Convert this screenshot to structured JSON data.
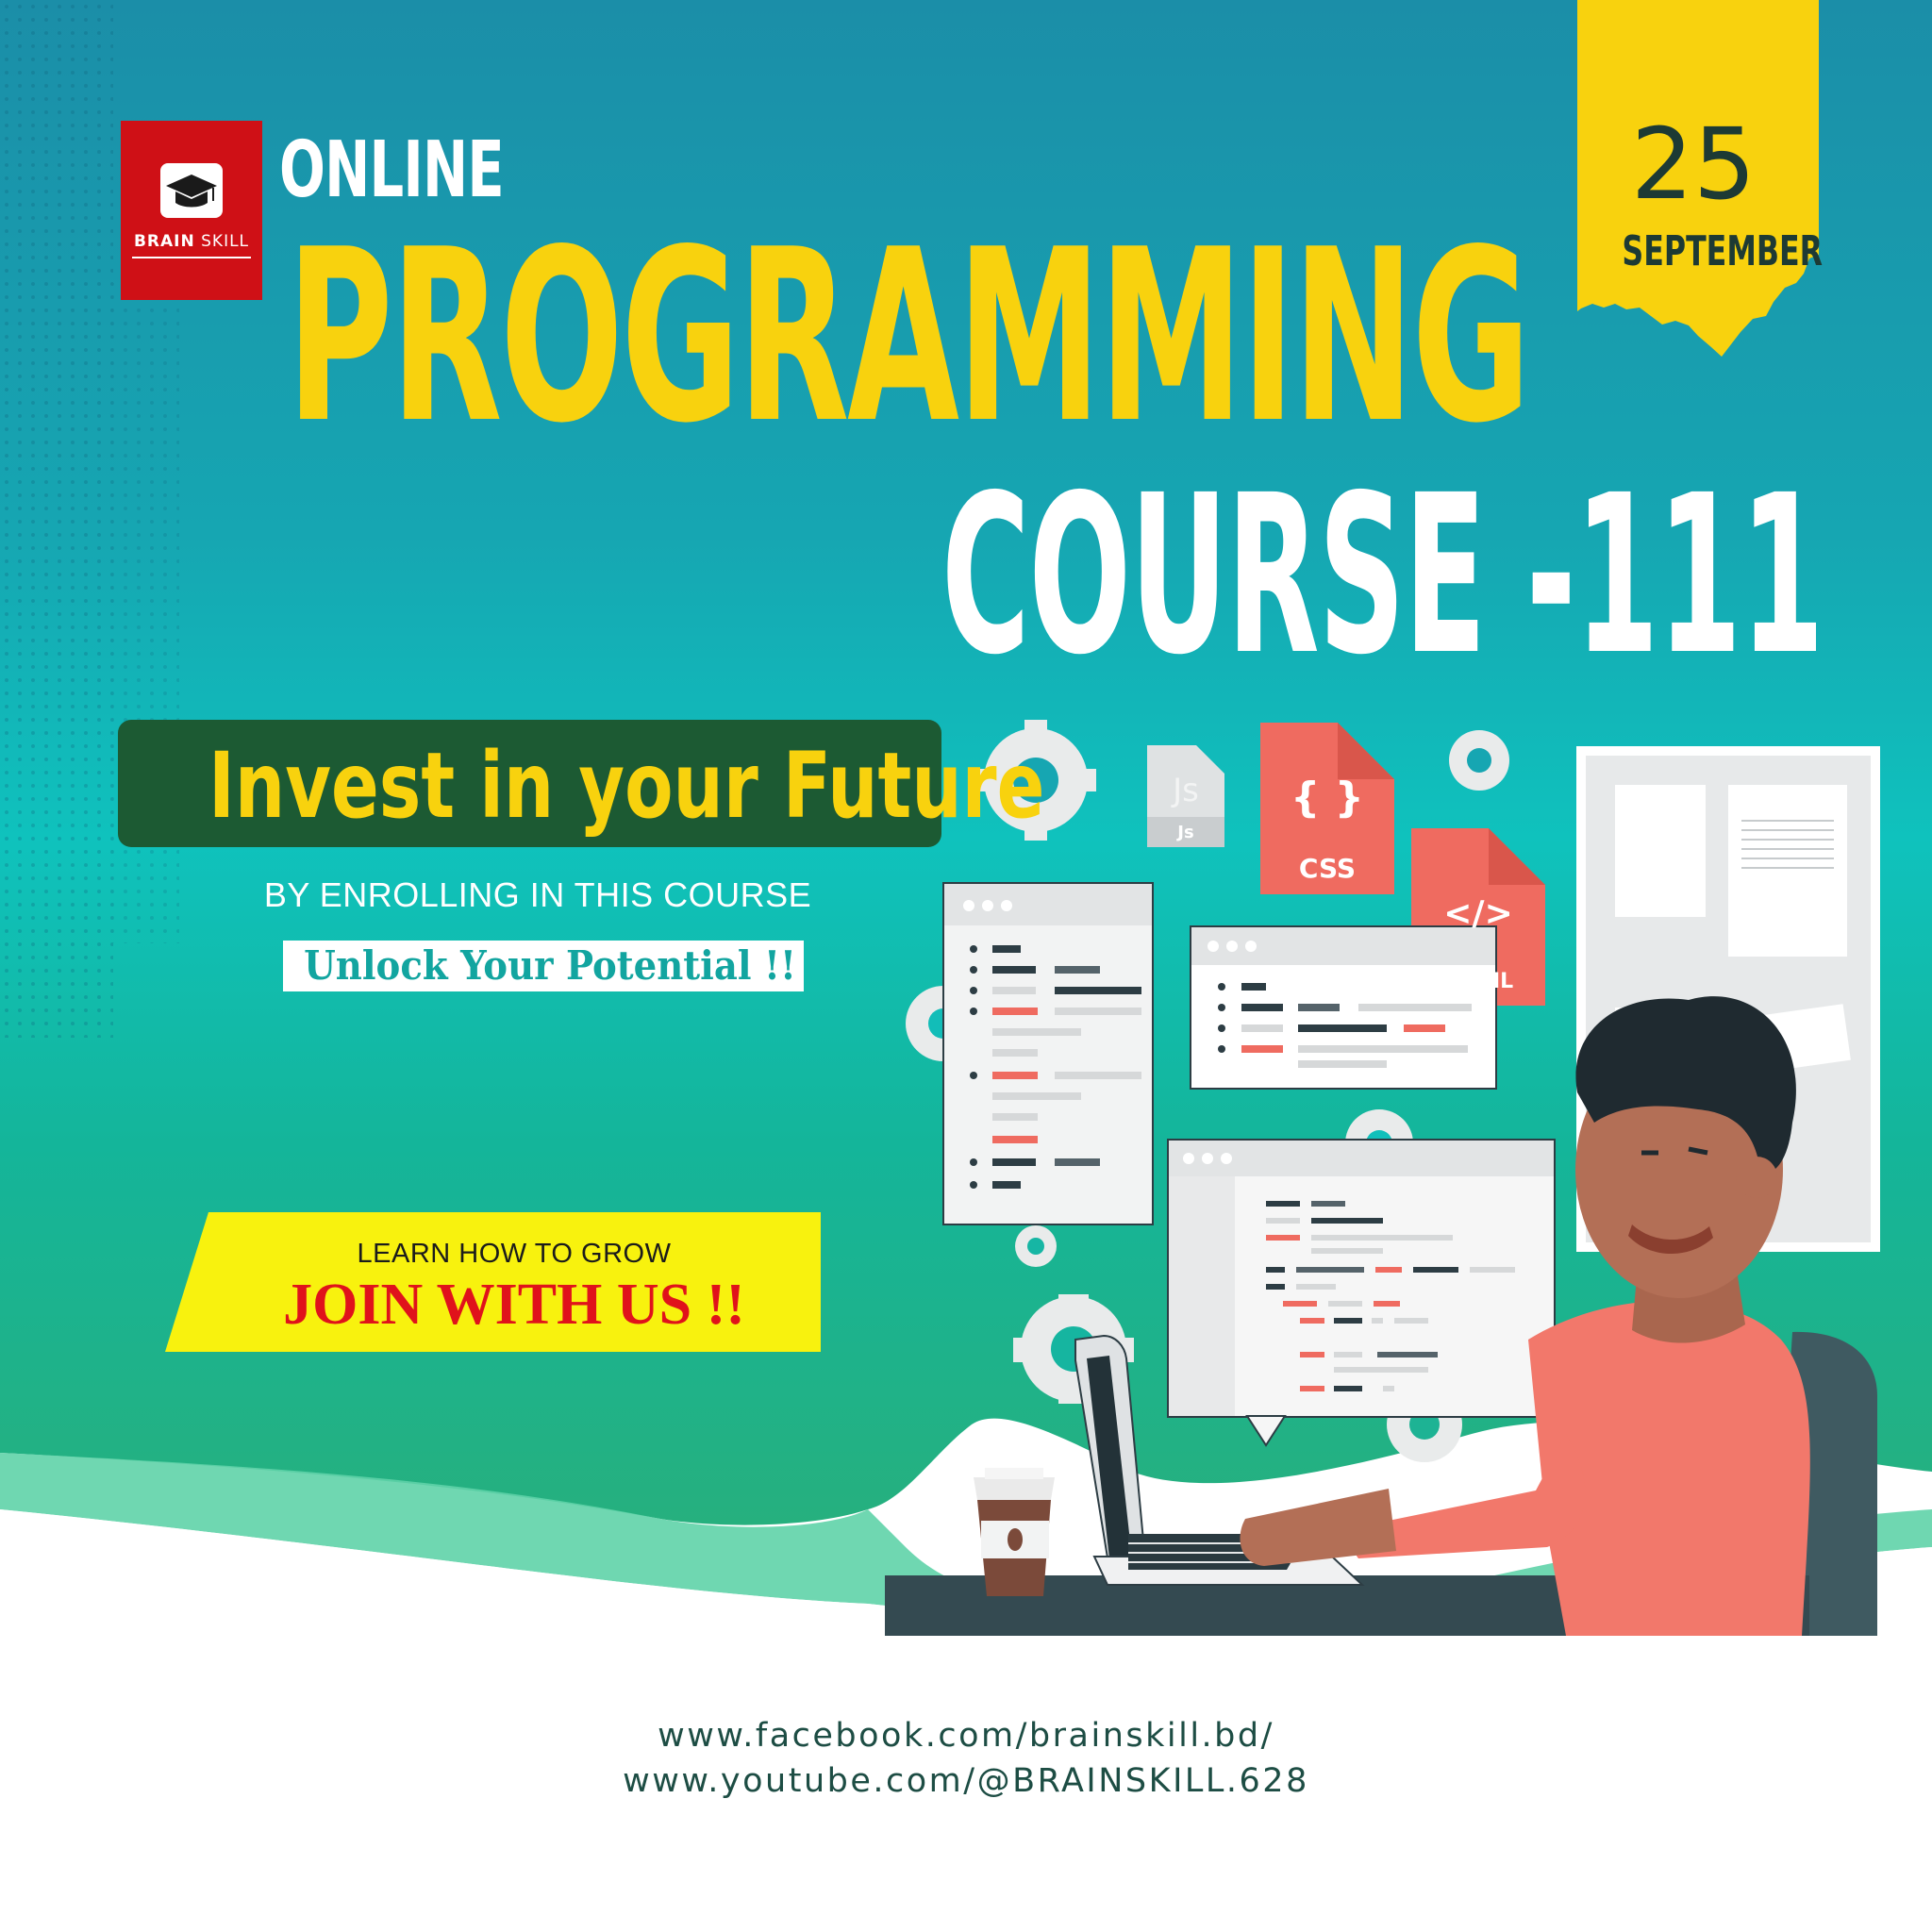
{
  "brand": {
    "name_bold": "BRAIN",
    "name_light": "SKILL"
  },
  "headline": {
    "prefix": "ONLINE",
    "main": "PROGRAMMING",
    "course": "COURSE -111"
  },
  "date": {
    "day": "25",
    "month": "SEPTEMBER"
  },
  "promo": {
    "invest": "Invest in your Future",
    "enroll": "BY ENROLLING IN THIS COURSE",
    "unlock": "Unlock Your Potential !!"
  },
  "cta": {
    "line1": "LEARN HOW TO GROW",
    "line2": "JOIN WITH US !!"
  },
  "illustration": {
    "file_js": "Js",
    "file_css": "CSS",
    "file_html": "</>",
    "file_html_tag": "IL"
  },
  "links": {
    "facebook": "www.facebook.com/brainskill.bd/",
    "youtube": "www.youtube.com/@BRAINSKILL.628"
  },
  "colors": {
    "teal": "#1a9fa8",
    "green": "#22b58a",
    "yellow": "#f8d20e",
    "red": "#cf1016",
    "dark_green": "#1c5a33"
  }
}
